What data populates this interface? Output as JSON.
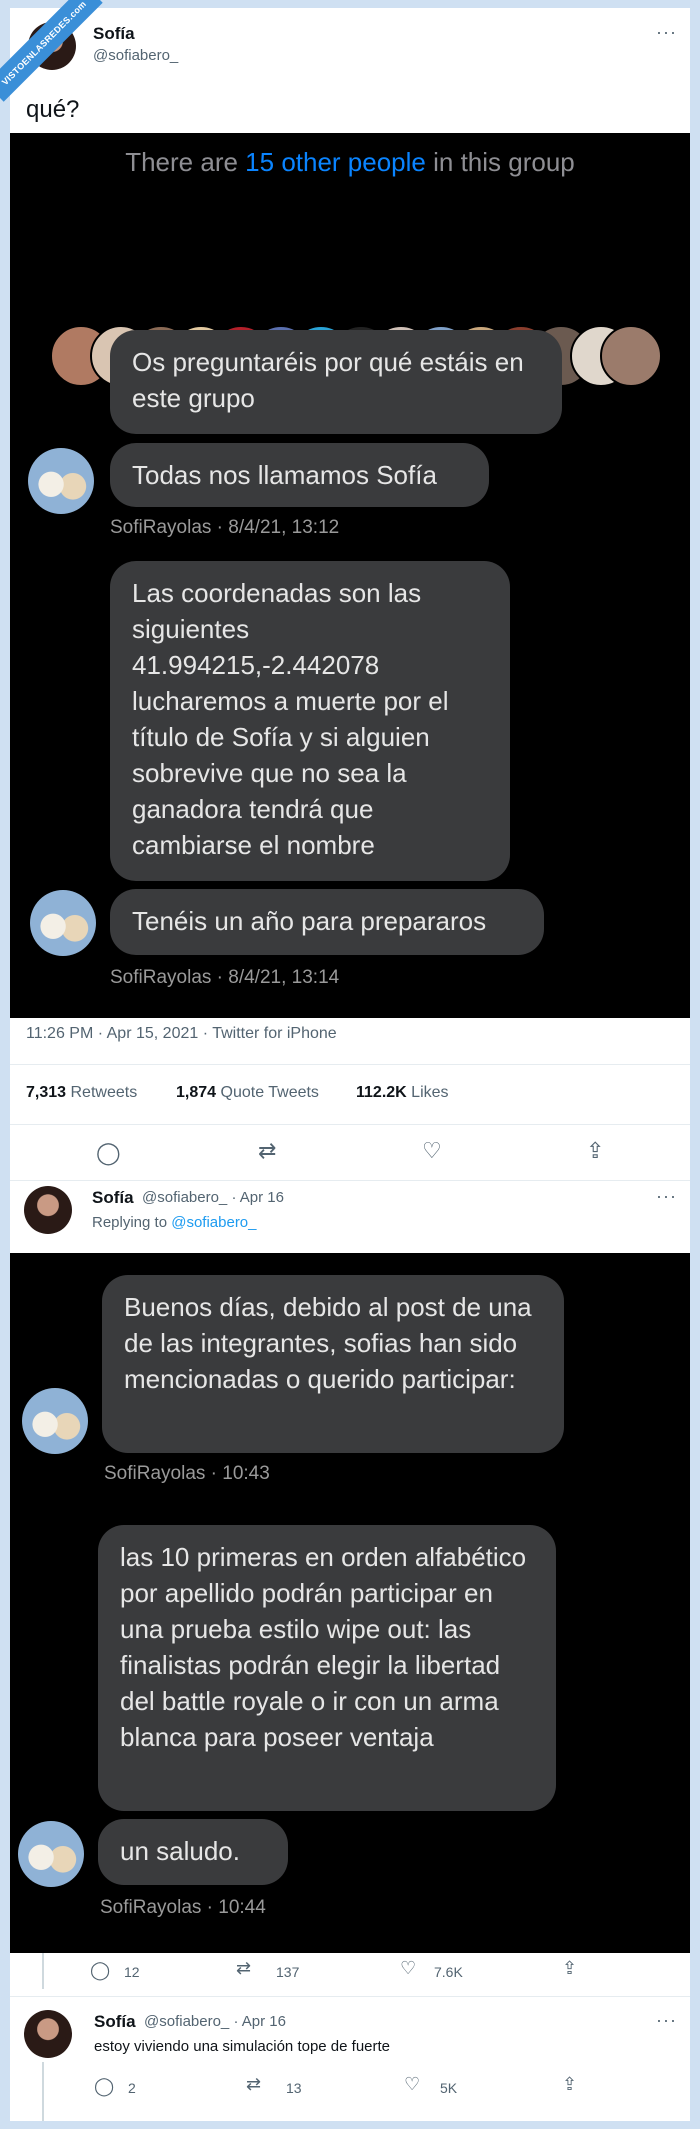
{
  "banner": "VISTOENLASREDES.com",
  "tweet": {
    "name": "Sofía",
    "handle": "@sofiabero_",
    "text": "qué?",
    "timestamp": "11:26 PM · Apr 15, 2021 · Twitter for iPhone",
    "retweets_count": "7,313",
    "retweets_label": "Retweets",
    "quotes_count": "1,874",
    "quotes_label": "Quote Tweets",
    "likes_count": "112.2K",
    "likes_label": "Likes"
  },
  "screenshot1": {
    "group_prefix": "There are ",
    "group_link": "15 other people",
    "group_suffix": " in this group",
    "messages": [
      "Os preguntaréis por qué estáis en este grupo",
      "Todas nos llamamos Sofía",
      "Las coordenadas son las siguientes 41.994215,-2.442078 lucharemos a muerte por el título de Sofía y si alguien sobrevive que no sea la ganadora tendrá que cambiarse el nombre",
      "Tenéis un año para prepararos"
    ],
    "sender1": "SofiRayolas · 8/4/21, 13:12",
    "sender2": "SofiRayolas · 8/4/21, 13:14"
  },
  "reply1": {
    "name": "Sofía",
    "handle_date": "@sofiabero_ · Apr 16",
    "replying_prefix": "Replying to ",
    "replying_handle": "@sofiabero_",
    "replies": "12",
    "retweets": "137",
    "likes": "7.6K"
  },
  "screenshot2": {
    "messages": [
      "Buenos días, debido al post de una de las integrantes, sofias han sido mencionadas o querido participar:",
      "las 10 primeras en orden alfabético por apellido podrán participar en una prueba estilo wipe out: las finalistas podrán elegir la libertad del battle royale o ir con un arma blanca para poseer ventaja",
      "un saludo."
    ],
    "sender1": "SofiRayolas · 10:43",
    "sender2": "SofiRayolas · 10:44"
  },
  "reply2": {
    "name": "Sofía",
    "handle_date": "@sofiabero_ · Apr 16",
    "text": "estoy viviendo una simulación tope de fuerte",
    "replies": "2",
    "retweets": "13",
    "likes": "5K"
  },
  "icons": [
    "more-icon",
    "reply-icon",
    "retweet-icon",
    "like-icon",
    "share-icon"
  ]
}
